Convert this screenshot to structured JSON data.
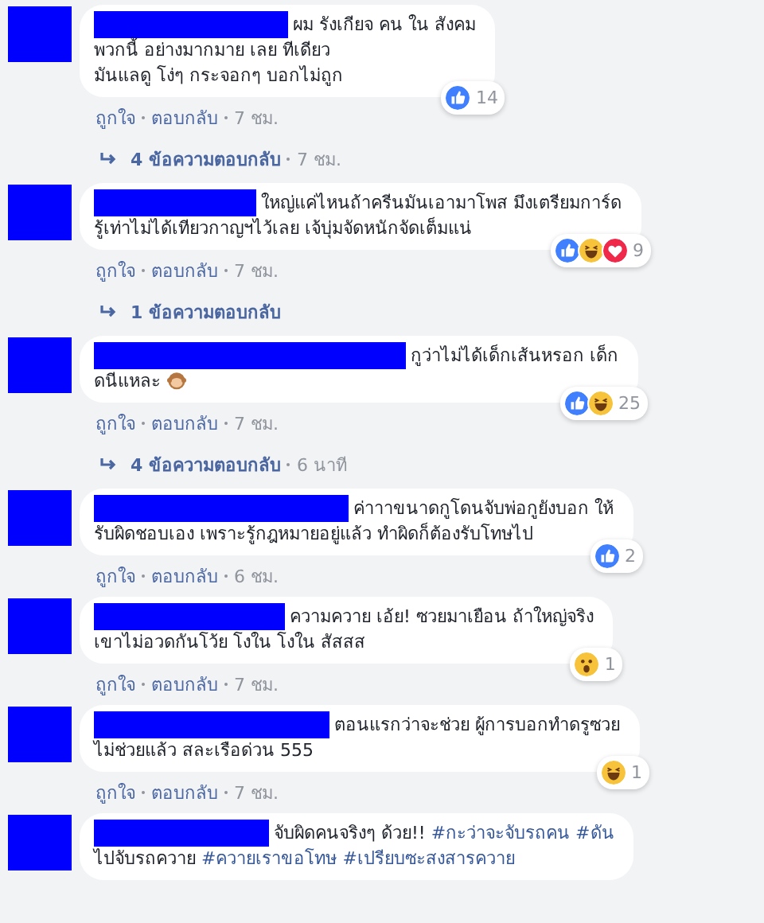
{
  "comments": [
    {
      "lines": [
        [
          {
            "kind": "text",
            "text": "ผม รังเกียจ คน ใน สังคม"
          }
        ],
        [
          {
            "kind": "text",
            "text": "พวกนี้ อย่างมากมาย เลย ทีเดียว"
          }
        ],
        [
          {
            "kind": "text",
            "text": "มันแลดู โง่ๆ กระจอกๆ บอกไม่ถูก"
          }
        ]
      ],
      "reactions": [
        {
          "kind": "like"
        }
      ],
      "reaction_count": "14",
      "actions": [
        "ถูกใจ",
        "ตอบกลับ"
      ],
      "time": "7 ชม.",
      "replies": {
        "label": "4 ข้อความตอบกลับ",
        "time": "7 ชม."
      }
    },
    {
      "lines": [
        [
          {
            "kind": "text",
            "text": "ใหญ่แค่ไหนถ้าครีนมันเอามาโพส มึงเตรียมการ์ด"
          }
        ],
        [
          {
            "kind": "text",
            "text": "รู้เท่าไม่ได้เทียวกาญฯไว้เลย เจ้บุ่มจัดหนักจัดเต็มแน่"
          }
        ]
      ],
      "reactions": [
        {
          "kind": "like"
        },
        {
          "kind": "haha"
        },
        {
          "kind": "love"
        }
      ],
      "reaction_count": "9",
      "actions": [
        "ถูกใจ",
        "ตอบกลับ"
      ],
      "time": "7 ชม.",
      "replies": {
        "label": "1 ข้อความตอบกลับ"
      }
    },
    {
      "lines": [
        [
          {
            "kind": "text",
            "text": "กูว่าไม่ได้เด็กเส้นหรอก เด็ก"
          }
        ],
        [
          {
            "kind": "text",
            "text": "ดนีแหละ"
          },
          {
            "kind": "emoji"
          }
        ]
      ],
      "reactions": [
        {
          "kind": "like"
        },
        {
          "kind": "haha"
        }
      ],
      "reaction_count": "25",
      "actions": [
        "ถูกใจ",
        "ตอบกลับ"
      ],
      "time": "7 ชม.",
      "replies": {
        "label": "4 ข้อความตอบกลับ",
        "time": "6 นาที"
      }
    },
    {
      "lines": [
        [
          {
            "kind": "text",
            "text": "ค่าาาขนาดกูโดนจับพ่อกูยังบอก ให้"
          }
        ],
        [
          {
            "kind": "text",
            "text": "รับผิดชอบเอง เพราะรู้กฎหมายอยู่แล้ว ทำผิดก็ต้องรับโทษไป"
          }
        ]
      ],
      "reactions": [
        {
          "kind": "like"
        }
      ],
      "reaction_count": "2",
      "actions": [
        "ถูกใจ",
        "ตอบกลับ"
      ],
      "time": "6 ชม."
    },
    {
      "lines": [
        [
          {
            "kind": "text",
            "text": "ความควาย เอ้ย! ซวยมาเยือน ถ้าใหญ่จริง"
          }
        ],
        [
          {
            "kind": "text",
            "text": "เขาไม่อวดกันโว้ย โงใน โงใน สัสสส"
          }
        ]
      ],
      "reactions": [
        {
          "kind": "wow"
        }
      ],
      "reaction_count": "1",
      "actions": [
        "ถูกใจ",
        "ตอบกลับ"
      ],
      "time": "7 ชม."
    },
    {
      "lines": [
        [
          {
            "kind": "text",
            "text": "ตอนแรกว่าจะช่วย ผู้การบอกทำดรูซวย"
          }
        ],
        [
          {
            "kind": "text",
            "text": "ไม่ช่วยแล้ว สละเรือด่วน 555"
          }
        ]
      ],
      "reactions": [
        {
          "kind": "haha"
        }
      ],
      "reaction_count": "1",
      "actions": [
        "ถูกใจ",
        "ตอบกลับ"
      ],
      "time": "7 ชม."
    },
    {
      "lines": [
        [
          {
            "kind": "text",
            "text": "จับผิดคนจริงๆ ด้วย!!"
          },
          {
            "kind": "hashtag",
            "text": "#กะว่าจะจับรถคน"
          },
          {
            "kind": "hashtag",
            "text": "#ดัน"
          }
        ],
        [
          {
            "kind": "text",
            "text": "ไปจับรถควาย"
          },
          {
            "kind": "hashtag",
            "text": "#ควายเราขอโทษ"
          },
          {
            "kind": "hashtag",
            "text": "#เปรียบซะสงสารควาย"
          }
        ]
      ]
    }
  ]
}
